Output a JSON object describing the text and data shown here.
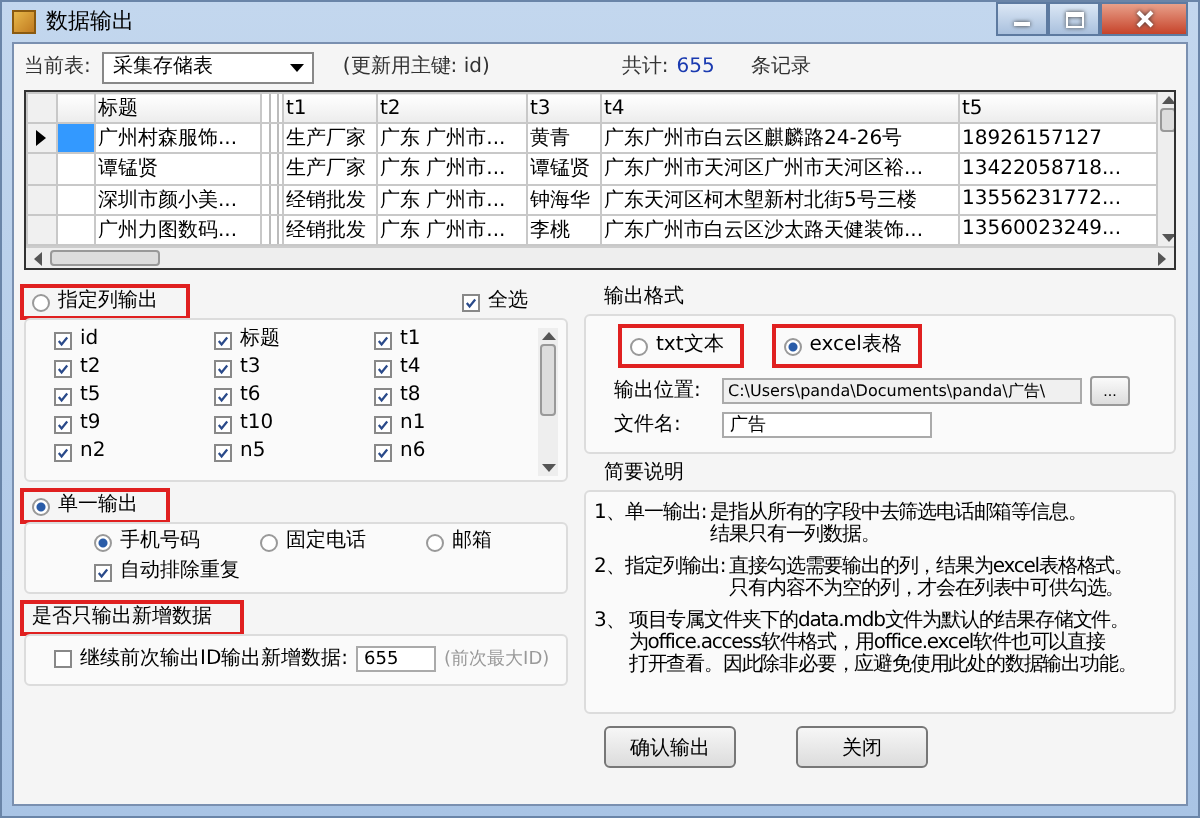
{
  "window": {
    "title": "数据输出"
  },
  "toolbar": {
    "table_label": "当前表:",
    "table_select": "采集存储表",
    "key_note": "(更新用主键: id)",
    "total_label": "共计:",
    "total": "655",
    "unit": "条记录"
  },
  "grid": {
    "columns": [
      "标题",
      "t1",
      "t2",
      "t3",
      "t4",
      "t5"
    ],
    "rows": [
      {
        "current": true,
        "cells": [
          "广州村森服饰...",
          "生产厂家",
          "广东 广州市...",
          "黄青",
          "广东广州市白云区麒麟路24-26号",
          "18926157127"
        ]
      },
      {
        "current": false,
        "cells": [
          "谭锰贤",
          "生产厂家",
          "广东 广州市...",
          "谭锰贤",
          "广东广州市天河区广州市天河区裕...",
          "13422058718..."
        ]
      },
      {
        "current": false,
        "cells": [
          "深圳市颜小美...",
          "经销批发",
          "广东 广州市...",
          "钟海华",
          "广东天河区柯木塱新村北街5号三楼",
          "13556231772..."
        ]
      },
      {
        "current": false,
        "cells": [
          "广州力图数码...",
          "经销批发",
          "广东 广州市...",
          "李桃",
          "广东广州市白云区沙太路天健装饰...",
          "13560023249..."
        ]
      }
    ]
  },
  "column_select": {
    "label": "指定列输出",
    "selected": false,
    "highlighted": true,
    "select_all": {
      "label": "全选",
      "checked": true
    },
    "fields": [
      {
        "label": "id",
        "checked": true
      },
      {
        "label": "标题",
        "checked": true
      },
      {
        "label": "t1",
        "checked": true
      },
      {
        "label": "t2",
        "checked": true
      },
      {
        "label": "t3",
        "checked": true
      },
      {
        "label": "t4",
        "checked": true
      },
      {
        "label": "t5",
        "checked": true
      },
      {
        "label": "t6",
        "checked": true
      },
      {
        "label": "t8",
        "checked": true
      },
      {
        "label": "t9",
        "checked": true
      },
      {
        "label": "t10",
        "checked": true
      },
      {
        "label": "n1",
        "checked": true
      },
      {
        "label": "n2",
        "checked": true
      },
      {
        "label": "n5",
        "checked": true
      },
      {
        "label": "n6",
        "checked": true
      }
    ]
  },
  "single_output": {
    "label": "单一输出",
    "selected": true,
    "highlighted": true,
    "options": [
      {
        "label": "手机号码",
        "selected": true
      },
      {
        "label": "固定电话",
        "selected": false
      },
      {
        "label": "邮箱",
        "selected": false
      }
    ],
    "dedupe": {
      "label": "自动排除重复",
      "checked": true
    }
  },
  "new_only": {
    "label": "是否只输出新增数据",
    "highlighted": true,
    "continue": {
      "label": "继续前次输出ID输出新增数据:",
      "checked": false
    },
    "last_id": "655",
    "hint": "(前次最大ID)"
  },
  "format": {
    "label": "输出格式",
    "options": [
      {
        "label": "txt文本",
        "selected": false,
        "highlighted": true
      },
      {
        "label": "excel表格",
        "selected": true,
        "highlighted": true
      }
    ],
    "location_label": "输出位置:",
    "location": "C:\\Users\\panda\\Documents\\panda\\广告\\",
    "browse": "...",
    "filename_label": "文件名:",
    "filename": "广告"
  },
  "notes": {
    "label": "简要说明",
    "items": [
      {
        "label": "1、单一输出:",
        "lines": [
          "是指从所有的字段中去筛选电话邮箱等信息。",
          "结果只有一列数据。"
        ]
      },
      {
        "label": "2、指定列输出:",
        "lines": [
          "直接勾选需要输出的列，结果为excel表格格式。",
          "只有内容不为空的列，才会在列表中可供勾选。"
        ]
      },
      {
        "label": "3、",
        "lines": [
          "项目专属文件夹下的data.mdb文件为默认的结果存储文件。",
          "为office.access软件格式，用office.excel软件也可以直接",
          "打开查看。因此除非必要，应避免使用此处的数据输出功能。"
        ]
      }
    ]
  },
  "buttons": [
    "确认输出",
    "关闭"
  ]
}
